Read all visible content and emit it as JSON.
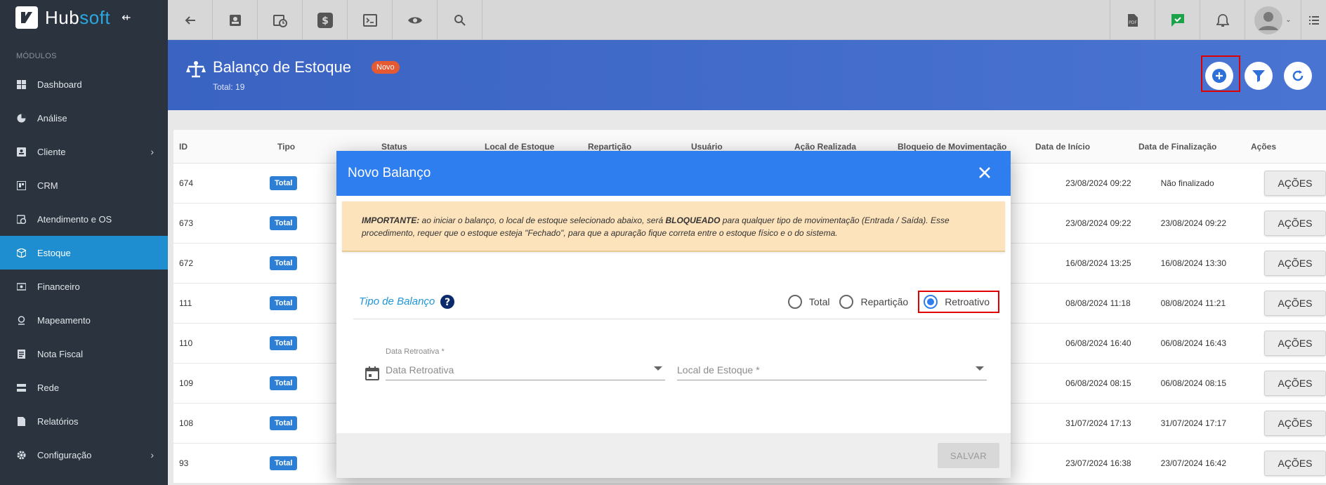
{
  "brand": {
    "name_part1": "Hub",
    "name_part2": "soft"
  },
  "sidebar": {
    "section": "MÓDULOS",
    "items": [
      {
        "label": "Dashboard",
        "icon": "grid-icon"
      },
      {
        "label": "Análise",
        "icon": "pie-chart-icon"
      },
      {
        "label": "Cliente",
        "icon": "contact-card-icon",
        "has_submenu": true
      },
      {
        "label": "CRM",
        "icon": "board-icon"
      },
      {
        "label": "Atendimento e OS",
        "icon": "calendar-clock-icon"
      },
      {
        "label": "Estoque",
        "icon": "box-icon",
        "active": true
      },
      {
        "label": "Financeiro",
        "icon": "money-icon"
      },
      {
        "label": "Mapeamento",
        "icon": "map-pin-icon"
      },
      {
        "label": "Nota Fiscal",
        "icon": "document-icon"
      },
      {
        "label": "Rede",
        "icon": "server-icon"
      },
      {
        "label": "Relatórios",
        "icon": "report-icon"
      },
      {
        "label": "Configuração",
        "icon": "gear-icon",
        "has_submenu": true
      }
    ]
  },
  "header": {
    "title": "Balanço de Estoque",
    "badge": "Novo",
    "total": "Total: 19"
  },
  "table": {
    "columns": [
      "ID",
      "Tipo",
      "Status",
      "Local de Estoque",
      "Repartição",
      "Usuário",
      "Ação Realizada",
      "Bloqueio de Movimentação",
      "Data de Início",
      "Data de Finalização",
      "Ações"
    ],
    "rows": [
      {
        "id": "674",
        "tipo": "Total",
        "inicio": "23/08/2024 09:22",
        "fim": "Não finalizado",
        "acao": "AÇÕES"
      },
      {
        "id": "673",
        "tipo": "Total",
        "inicio": "23/08/2024 09:22",
        "fim": "23/08/2024 09:22",
        "acao": "AÇÕES"
      },
      {
        "id": "672",
        "tipo": "Total",
        "inicio": "16/08/2024 13:25",
        "fim": "16/08/2024 13:30",
        "acao": "AÇÕES"
      },
      {
        "id": "111",
        "tipo": "Total",
        "inicio": "08/08/2024 11:18",
        "fim": "08/08/2024 11:21",
        "acao": "AÇÕES"
      },
      {
        "id": "110",
        "tipo": "Total",
        "inicio": "06/08/2024 16:40",
        "fim": "06/08/2024 16:43",
        "acao": "AÇÕES"
      },
      {
        "id": "109",
        "tipo": "Total",
        "inicio": "06/08/2024 08:15",
        "fim": "06/08/2024 08:15",
        "acao": "AÇÕES"
      },
      {
        "id": "108",
        "tipo": "Total",
        "inicio": "31/07/2024 17:13",
        "fim": "31/07/2024 17:17",
        "acao": "AÇÕES"
      },
      {
        "id": "93",
        "tipo": "Total",
        "inicio": "23/07/2024 16:38",
        "fim": "23/07/2024 16:42",
        "acao": "AÇÕES"
      }
    ]
  },
  "modal": {
    "title": "Novo Balanço",
    "alert": {
      "lead": "IMPORTANTE:",
      "part1": " ao iniciar o balanço, o local de estoque selecionado abaixo, será ",
      "bold": "BLOQUEADO",
      "part2": " para qualquer tipo de movimentação (Entrada / Saída). Esse procedimento, requer que o estoque esteja \"Fechado\", para que a apuração fique correta entre o estoque físico e o do sistema."
    },
    "tipo_label": "Tipo de Balanço",
    "radios": [
      {
        "label": "Total",
        "selected": false
      },
      {
        "label": "Repartição",
        "selected": false
      },
      {
        "label": "Retroativo",
        "selected": true
      }
    ],
    "data_retroativa": {
      "float_label": "Data Retroativa *",
      "placeholder": "Data Retroativa"
    },
    "local_estoque": {
      "placeholder": "Local de Estoque *"
    },
    "save_label": "SALVAR"
  }
}
